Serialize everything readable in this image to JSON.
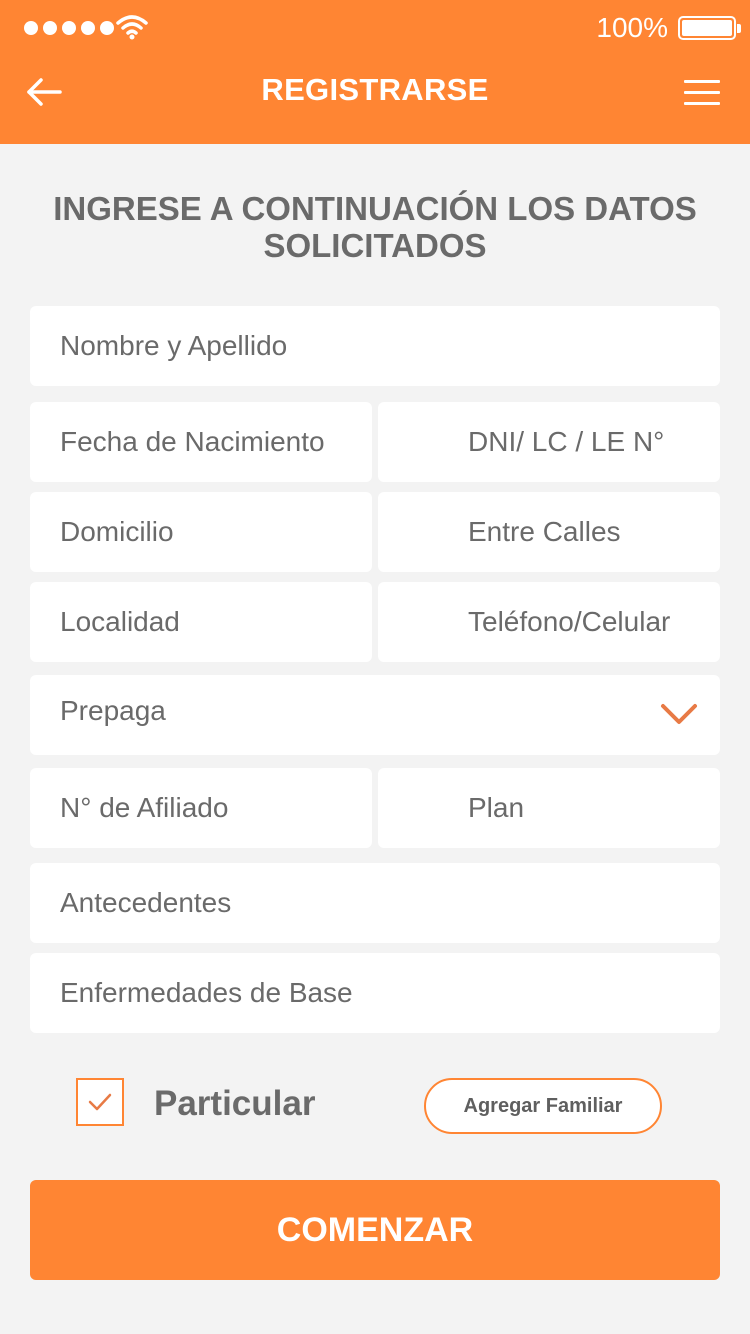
{
  "status_bar": {
    "battery_percent": "100%",
    "signal_bars": 5
  },
  "header": {
    "title": "REGISTRARSE",
    "back_icon": "arrow-left-icon",
    "menu_icon": "hamburger-menu-icon"
  },
  "form": {
    "subtitle": "INGRESE A CONTINUACIÓN LOS DATOS SOLICITADOS",
    "fields": {
      "nombre": "Nombre y Apellido",
      "fecha_nacimiento": "Fecha de Nacimiento",
      "documento": "DNI/ LC / LE N°",
      "domicilio": "Domicilio",
      "entre_calles": "Entre Calles",
      "localidad": "Localidad",
      "telefono": "Teléfono/Celular",
      "prepaga": "Prepaga",
      "afiliado": "N° de Afiliado",
      "plan": "Plan",
      "antecedentes": "Antecedentes",
      "enfermedades": "Enfermedades de Base"
    },
    "particular_label": "Particular",
    "particular_checked": true,
    "add_family_label": "Agregar Familiar",
    "submit_label": "COMENZAR"
  },
  "colors": {
    "accent": "#ff8533",
    "background": "#f3f3f3",
    "field_bg": "#ffffff",
    "text": "#6a6a6a"
  }
}
